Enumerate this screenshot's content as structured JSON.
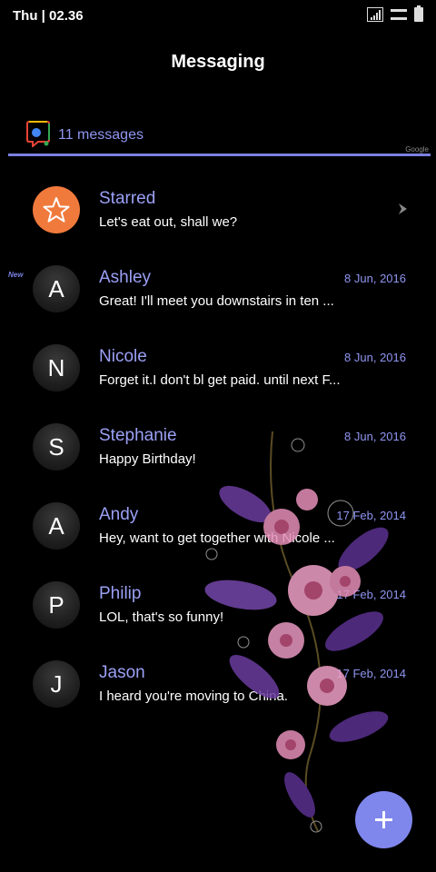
{
  "status_bar": {
    "time": "Thu | 02.36"
  },
  "header": {
    "title": "Messaging"
  },
  "assistant": {
    "count_label": "11 messages",
    "brand": "Google"
  },
  "new_badge": "New",
  "conversations": [
    {
      "avatar": "",
      "name": "Starred",
      "preview": "Let's eat out, shall we?",
      "date": ""
    },
    {
      "avatar": "A",
      "name": "Ashley",
      "preview": "Great! I'll meet you downstairs in ten ...",
      "date": "8 Jun, 2016"
    },
    {
      "avatar": "N",
      "name": "Nicole",
      "preview": "Forget it.I don't bl get paid. until next F...",
      "date": "8 Jun, 2016"
    },
    {
      "avatar": "S",
      "name": "Stephanie",
      "preview": "Happy Birthday!",
      "date": "8 Jun, 2016"
    },
    {
      "avatar": "A",
      "name": "Andy",
      "preview": "Hey, want to get together with Nicole ...",
      "date": "17 Feb, 2014"
    },
    {
      "avatar": "P",
      "name": "Philip",
      "preview": "LOL, that's so funny!",
      "date": "17 Feb, 2014"
    },
    {
      "avatar": "J",
      "name": "Jason",
      "preview": "I heard you're moving to China.",
      "date": "17 Feb, 2014"
    }
  ],
  "colors": {
    "accent": "#7f86ec",
    "name_text": "#9ba0f5",
    "starred_avatar": "#f07a3c",
    "background": "#000000"
  },
  "icons": {
    "starred": "star-icon",
    "open": "chevron-right-icon",
    "compose": "plus-icon"
  }
}
